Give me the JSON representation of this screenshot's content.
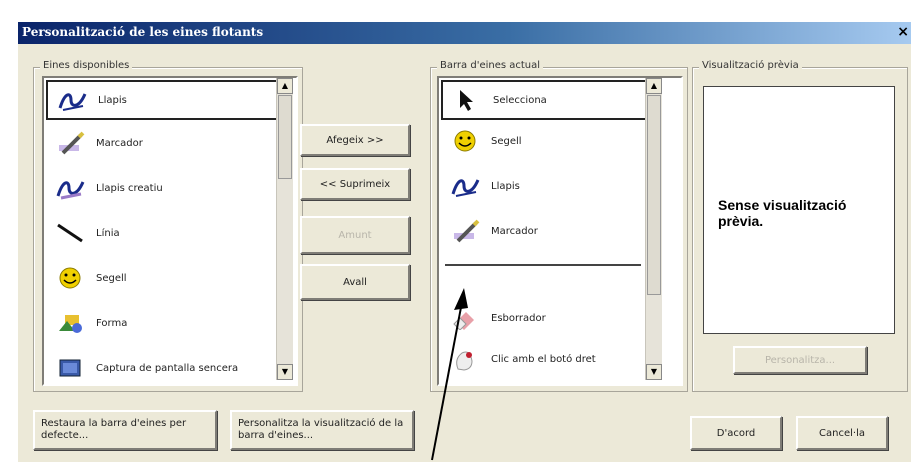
{
  "window": {
    "title": "Personalització de les eines flotants",
    "close_glyph": "×"
  },
  "available": {
    "label": "Eines disponibles",
    "items": [
      {
        "label": "Llapis",
        "icon": "pen-icon"
      },
      {
        "label": "Marcador",
        "icon": "highlighter-icon"
      },
      {
        "label": "Llapis creatiu",
        "icon": "creative-pen-icon"
      },
      {
        "label": "Línia",
        "icon": "line-icon"
      },
      {
        "label": "Segell",
        "icon": "stamp-icon"
      },
      {
        "label": "Forma",
        "icon": "shape-icon"
      },
      {
        "label": "Captura de pantalla sencera",
        "icon": "screen-capture-icon"
      }
    ]
  },
  "actions": {
    "add": "Afegeix >>",
    "remove": "<< Suprimeix",
    "up": "Amunt",
    "down": "Avall"
  },
  "current": {
    "label": "Barra d'eines actual",
    "items": [
      {
        "label": "Selecciona",
        "icon": "select-arrow-icon"
      },
      {
        "label": "Segell",
        "icon": "stamp-icon"
      },
      {
        "label": "Llapis",
        "icon": "pen-icon"
      },
      {
        "label": "Marcador",
        "icon": "highlighter-icon"
      },
      {
        "label": "Esborrador",
        "icon": "eraser-icon"
      },
      {
        "label": "Clic amb el botó dret",
        "icon": "right-click-icon"
      }
    ]
  },
  "preview": {
    "label": "Visualització prèvia",
    "empty_text": "Sense visualització prèvia.",
    "customize_button": "Personalitza..."
  },
  "footer": {
    "restore_button": "Restaura la barra d'eines per defecte...",
    "customize_view_button": "Personalitza la visualització de la barra d'eines...",
    "ok_button": "D'acord",
    "cancel_button": "Cancel·la"
  },
  "colors": {
    "titlebar_start": "#0a246a",
    "dialog_bg": "#ece9d8",
    "disabled_text": "#b8b5aa"
  }
}
